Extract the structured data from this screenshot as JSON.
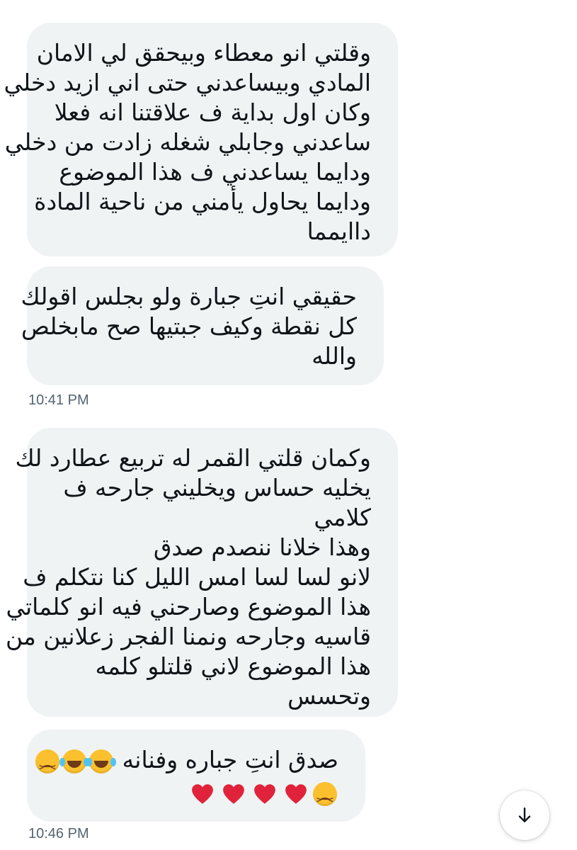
{
  "messages": [
    {
      "lines": [
        "وقلتي انو معطاء وبيحقق لي الامان",
        "المادي وبيساعدني حتى اني ازيد دخلي",
        "وكان اول بداية ف علاقتنا انه فعلا",
        "ساعدني وجابلي شغله زادت من دخلي",
        "ودايما يساعدني ف هذا الموضوع",
        "ودايما يحاول يأمني من ناحية المادة",
        "داايمما"
      ]
    },
    {
      "lines": [
        "حقيقي انتِ جبارة ولو بجلس اقولك",
        "كل نقطة وكيف جبتيها صح مابخلص",
        "والله"
      ]
    },
    {
      "lines": [
        "وكمان قلتي القمر له تربيع عطارد لك",
        "يخليه حساس ويخليني جارحه ف",
        "كلامي",
        "وهذا خلانا ننصدم صدق",
        "لانو لسا لسا امس الليل كنا نتكلم ف",
        "هذا الموضوع وصارحني فيه انو كلماتي",
        "قاسيه وجارحه ونمنا الفجر زعلانين من",
        "هذا الموضوع لاني قلتلو كلمه",
        "وتحسس"
      ]
    },
    {
      "text": "صدق انتِ جباره وفنانه",
      "emoji_row1": [
        "face-with-tears-of-joy",
        "face-with-tears-of-joy",
        "persevering-face"
      ],
      "emoji_row2": [
        "persevering-face",
        "red-heart",
        "red-heart",
        "red-heart",
        "red-heart"
      ]
    }
  ],
  "timestamps": {
    "first": "10:41 PM",
    "second": "10:46 PM"
  },
  "scroll_button": {
    "icon": "arrow-down-icon"
  },
  "colors": {
    "bubble": "#eff3f4",
    "text": "#0f1419",
    "timestamp": "#536471",
    "heart": "#e0233a"
  }
}
